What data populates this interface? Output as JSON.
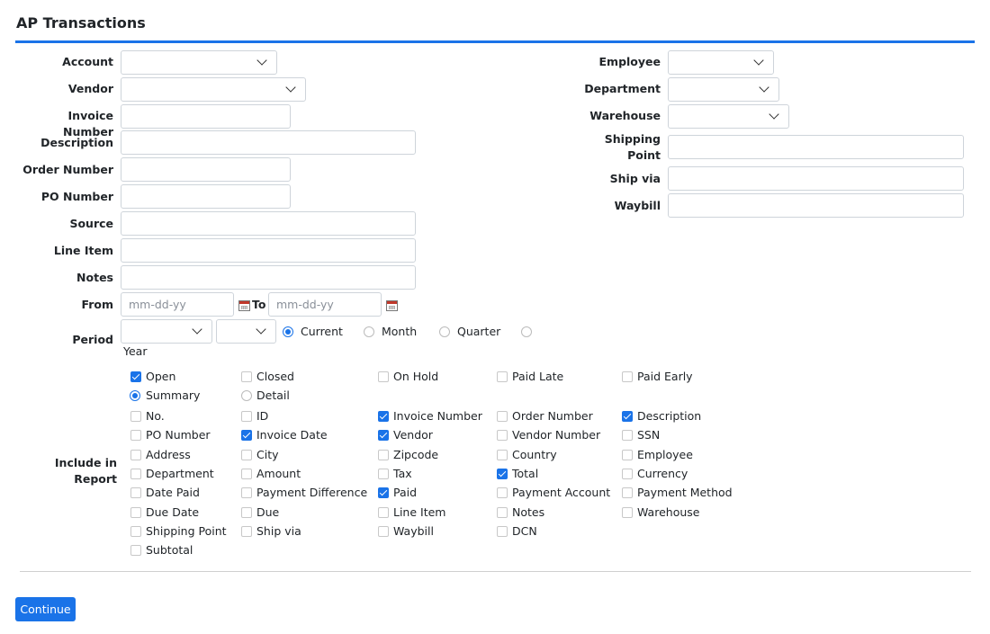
{
  "page": {
    "title": "AP Transactions"
  },
  "fields": {
    "account": {
      "label": "Account",
      "value": ""
    },
    "vendor": {
      "label": "Vendor",
      "value": ""
    },
    "invoice_number": {
      "label": "Invoice Number",
      "value": ""
    },
    "description": {
      "label": "Description",
      "value": ""
    },
    "order_number": {
      "label": "Order Number",
      "value": ""
    },
    "po_number": {
      "label": "PO Number",
      "value": ""
    },
    "source": {
      "label": "Source",
      "value": ""
    },
    "line_item": {
      "label": "Line Item",
      "value": ""
    },
    "notes": {
      "label": "Notes",
      "value": ""
    },
    "employee": {
      "label": "Employee",
      "value": ""
    },
    "department": {
      "label": "Department",
      "value": ""
    },
    "warehouse": {
      "label": "Warehouse",
      "value": ""
    },
    "shipping_point": {
      "label_line1": "Shipping",
      "label_line2": "Point",
      "value": ""
    },
    "ship_via": {
      "label": "Ship via",
      "value": ""
    },
    "waybill": {
      "label": "Waybill",
      "value": ""
    }
  },
  "date_range": {
    "from_label": "From",
    "to_label": "To",
    "from_placeholder": "mm-dd-yy",
    "to_placeholder": "mm-dd-yy",
    "from_value": "",
    "to_value": ""
  },
  "period": {
    "label": "Period",
    "year_value": "",
    "month_value": "",
    "options": [
      {
        "label": "Current",
        "selected": true
      },
      {
        "label": "Month",
        "selected": false
      },
      {
        "label": "Quarter",
        "selected": false
      },
      {
        "label": "Year",
        "selected": false
      }
    ]
  },
  "include_in_report": {
    "label": "Include in Report",
    "status": [
      {
        "label": "Open",
        "checked": true
      },
      {
        "label": "Closed",
        "checked": false
      },
      {
        "label": "On Hold",
        "checked": false
      },
      {
        "label": "Paid Late",
        "checked": false
      },
      {
        "label": "Paid Early",
        "checked": false
      }
    ],
    "report_type": [
      {
        "label": "Summary",
        "selected": true
      },
      {
        "label": "Detail",
        "selected": false
      }
    ],
    "columns": [
      [
        {
          "label": "No.",
          "checked": false
        },
        {
          "label": "ID",
          "checked": false
        },
        {
          "label": "Invoice Number",
          "checked": true
        },
        {
          "label": "Order Number",
          "checked": false
        },
        {
          "label": "Description",
          "checked": true
        }
      ],
      [
        {
          "label": "PO Number",
          "checked": false
        },
        {
          "label": "Invoice Date",
          "checked": true
        },
        {
          "label": "Vendor",
          "checked": true
        },
        {
          "label": "Vendor Number",
          "checked": false
        },
        {
          "label": "SSN",
          "checked": false
        }
      ],
      [
        {
          "label": "Address",
          "checked": false
        },
        {
          "label": "City",
          "checked": false
        },
        {
          "label": "Zipcode",
          "checked": false
        },
        {
          "label": "Country",
          "checked": false
        },
        {
          "label": "Employee",
          "checked": false
        }
      ],
      [
        {
          "label": "Department",
          "checked": false
        },
        {
          "label": "Amount",
          "checked": false
        },
        {
          "label": "Tax",
          "checked": false
        },
        {
          "label": "Total",
          "checked": true
        },
        {
          "label": "Currency",
          "checked": false
        }
      ],
      [
        {
          "label": "Date Paid",
          "checked": false
        },
        {
          "label": "Payment Difference",
          "checked": false
        },
        {
          "label": "Paid",
          "checked": true
        },
        {
          "label": "Payment Account",
          "checked": false
        },
        {
          "label": "Payment Method",
          "checked": false
        }
      ],
      [
        {
          "label": "Due Date",
          "checked": false
        },
        {
          "label": "Due",
          "checked": false
        },
        {
          "label": "Line Item",
          "checked": false
        },
        {
          "label": "Notes",
          "checked": false
        },
        {
          "label": "Warehouse",
          "checked": false
        }
      ],
      [
        {
          "label": "Shipping Point",
          "checked": false
        },
        {
          "label": "Ship via",
          "checked": false
        },
        {
          "label": "Waybill",
          "checked": false
        },
        {
          "label": "DCN",
          "checked": false
        }
      ],
      [
        {
          "label": "Subtotal",
          "checked": false
        }
      ]
    ]
  },
  "actions": {
    "continue_label": "Continue"
  },
  "colors": {
    "accent": "#1a73e8",
    "border": "#ced4da",
    "rule": "#d0d0d0"
  }
}
